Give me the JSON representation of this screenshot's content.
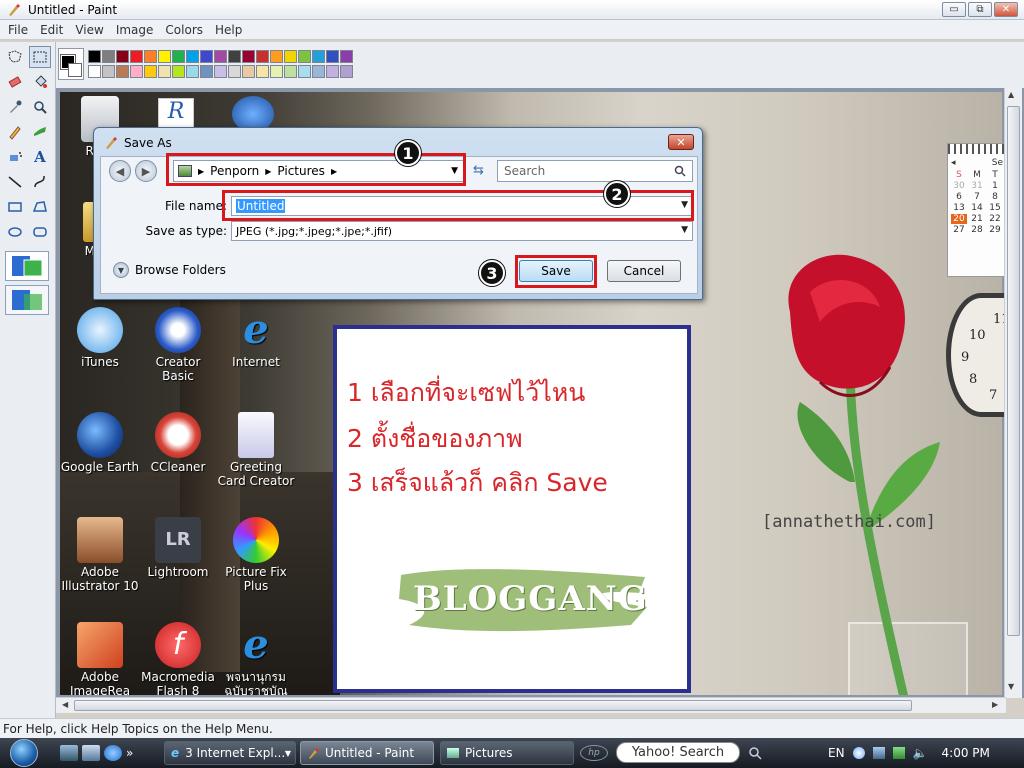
{
  "window": {
    "title": "Untitled - Paint",
    "controls": {
      "minimize": "▭",
      "restore": "⧉",
      "close": "✕"
    }
  },
  "menu": [
    "File",
    "Edit",
    "View",
    "Image",
    "Colors",
    "Help"
  ],
  "palette": {
    "row1": [
      "#000000",
      "#7f7f7f",
      "#880015",
      "#ed1c24",
      "#ff7f27",
      "#fff200",
      "#22b14c",
      "#00a2e8",
      "#3f48cc",
      "#a349a4",
      "#404040",
      "#990030",
      "#c8302b",
      "#ff9e1e",
      "#f2d400",
      "#7dc241",
      "#23a0d8",
      "#3050c0",
      "#8a3ea8"
    ],
    "row2": [
      "#ffffff",
      "#c3c3c3",
      "#b97a57",
      "#ffaec9",
      "#ffc90e",
      "#efe4b0",
      "#b5e61d",
      "#99d9ea",
      "#7092be",
      "#c8bfe7",
      "#d9d9d9",
      "#e8c9a0",
      "#f6e4a8",
      "#e6f0b0",
      "#c0e0a0",
      "#a8dcef",
      "#9cb4d8",
      "#c4b0e0",
      "#b0a0d0"
    ]
  },
  "status": {
    "help_text": "For Help, click Help Topics on the Help Menu."
  },
  "desktop_icons": [
    {
      "label": "Recy",
      "color": "#dcdcdc"
    },
    {
      "label": "MY D",
      "color": "#e8c050"
    },
    {
      "label": "iTunes",
      "color": "#4aa0e6"
    },
    {
      "label": "Creator Basic",
      "color": "#2a5bc8"
    },
    {
      "label": "Internet",
      "color": "#2c8ee0"
    },
    {
      "label": "Google Earth",
      "color": "#1d4ea0"
    },
    {
      "label": "CCleaner",
      "color": "#d9453a"
    },
    {
      "label": "Greeting Card Creator",
      "color": "#e3e3f0"
    },
    {
      "label": "Adobe Illustrator 10",
      "color": "#b06b3e"
    },
    {
      "label": "Lightroom",
      "color": "#3a3f47"
    },
    {
      "label": "Picture Fix Plus",
      "color": "#6b3aa8"
    },
    {
      "label": "Adobe ImageRea",
      "color": "#d04020"
    },
    {
      "label": "Macromedia Flash 8",
      "color": "#c92020"
    },
    {
      "label": "พจนานุกรม ฉบับราชบัณ",
      "color": "#2c8ee0"
    }
  ],
  "dialog": {
    "title": "Save As",
    "close": "✕",
    "breadcrumb": [
      "Penporn",
      "Pictures"
    ],
    "search_placeholder": "Search",
    "file_name_label": "File name:",
    "file_name_value": "Untitled",
    "save_type_label": "Save as type:",
    "save_type_value": "JPEG (*.jpg;*.jpeg;*.jpe;*.jfif)",
    "browse_folders": "Browse Folders",
    "save_button": "Save",
    "cancel_button": "Cancel"
  },
  "annotations": {
    "badge1": "1",
    "badge2": "2",
    "badge3": "3",
    "highlight_color": "#d8181c"
  },
  "note": {
    "line1": "1 เลือกที่จะเซฟไว้ไหน",
    "line2": "2 ตั้งชื่อของภาพ",
    "line3": "3 เสร็จแล้วก็ คลิก Save",
    "logo": "BLOGGANG"
  },
  "watermark": "[annathethai.com]",
  "calendar": {
    "month_abbr": "Se",
    "headers": [
      "S",
      "M",
      "T"
    ],
    "rows": [
      [
        "30",
        "31",
        "1"
      ],
      [
        "6",
        "7",
        "8"
      ],
      [
        "13",
        "14",
        "15"
      ],
      [
        "20",
        "21",
        "22"
      ],
      [
        "27",
        "28",
        "29"
      ]
    ],
    "today": "20"
  },
  "clock": {
    "numbers": [
      "11",
      "10",
      "9",
      "8",
      "7"
    ]
  },
  "taskbar": {
    "items": [
      {
        "label": "3 Internet Expl..."
      },
      {
        "label": "Untitled - Paint"
      },
      {
        "label": "Pictures"
      }
    ],
    "search": "Yahoo! Search",
    "lang": "EN",
    "time": "4:00 PM",
    "chevron": "»"
  }
}
